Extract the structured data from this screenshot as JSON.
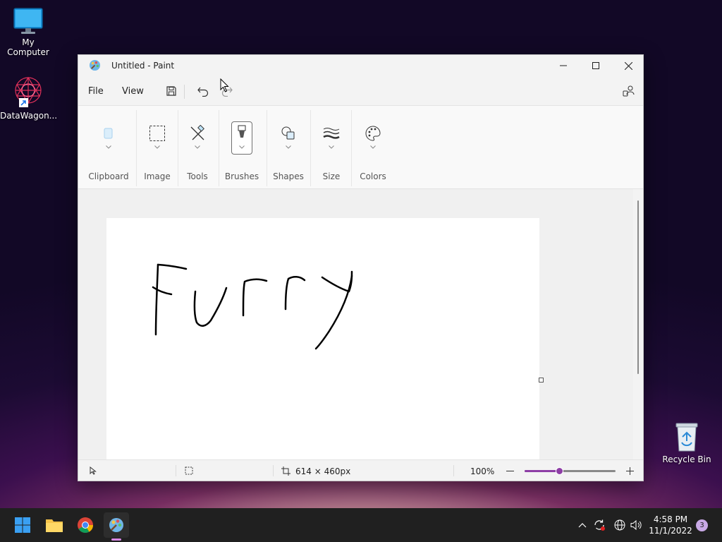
{
  "desktop": {
    "icons": [
      {
        "label": "My Computer",
        "icon": "monitor-icon"
      },
      {
        "label": "DataWagon...",
        "icon": "datawagon-shortcut-icon"
      },
      {
        "label": "Recycle Bin",
        "icon": "recycle-bin-icon"
      }
    ]
  },
  "window": {
    "title": "Untitled - Paint",
    "menu": {
      "file": "File",
      "view": "View"
    },
    "ribbon": {
      "groups": [
        "Clipboard",
        "Image",
        "Tools",
        "Brushes",
        "Shapes",
        "Size",
        "Colors"
      ]
    },
    "canvas": {
      "drawn_text": "Furry"
    },
    "status": {
      "dimensions": "614 × 460px",
      "zoom": "100%",
      "zoom_slider_fraction": 0.39
    }
  },
  "taskbar": {
    "apps": [
      "start-icon",
      "file-explorer-icon",
      "chrome-icon",
      "paint-icon"
    ],
    "time": "4:58 PM",
    "date": "11/1/2022",
    "notifications": "3"
  },
  "colors": {
    "accent": "#8e3ea6",
    "taskbar": "#202020",
    "ink": "#000000"
  }
}
